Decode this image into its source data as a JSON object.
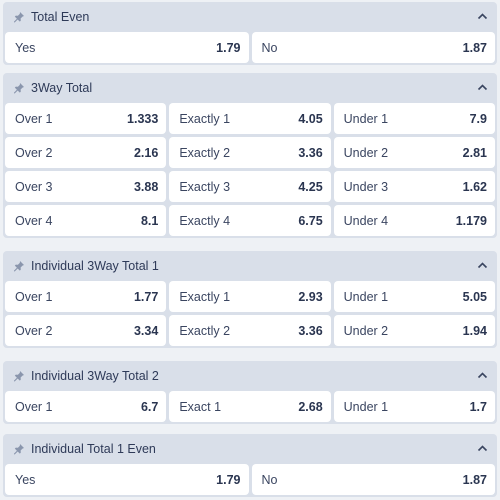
{
  "markets": [
    {
      "title": "Total Even",
      "outcomes": [
        {
          "label": "Yes",
          "odd": "1.79"
        },
        {
          "label": "No",
          "odd": "1.87"
        }
      ]
    },
    {
      "title": "3Way Total",
      "outcomes": [
        {
          "label": "Over 1",
          "odd": "1.333"
        },
        {
          "label": "Exactly 1",
          "odd": "4.05"
        },
        {
          "label": "Under 1",
          "odd": "7.9"
        },
        {
          "label": "Over 2",
          "odd": "2.16"
        },
        {
          "label": "Exactly 2",
          "odd": "3.36"
        },
        {
          "label": "Under 2",
          "odd": "2.81"
        },
        {
          "label": "Over 3",
          "odd": "3.88"
        },
        {
          "label": "Exactly 3",
          "odd": "4.25"
        },
        {
          "label": "Under 3",
          "odd": "1.62"
        },
        {
          "label": "Over 4",
          "odd": "8.1"
        },
        {
          "label": "Exactly 4",
          "odd": "6.75"
        },
        {
          "label": "Under 4",
          "odd": "1.179"
        }
      ]
    },
    {
      "title": "Individual 3Way Total 1",
      "outcomes": [
        {
          "label": "Over 1",
          "odd": "1.77"
        },
        {
          "label": "Exactly 1",
          "odd": "2.93"
        },
        {
          "label": "Under 1",
          "odd": "5.05"
        },
        {
          "label": "Over 2",
          "odd": "3.34"
        },
        {
          "label": "Exactly 2",
          "odd": "3.36"
        },
        {
          "label": "Under 2",
          "odd": "1.94"
        }
      ]
    },
    {
      "title": "Individual 3Way Total 2",
      "outcomes": [
        {
          "label": "Over 1",
          "odd": "6.7"
        },
        {
          "label": "Exact 1",
          "odd": "2.68"
        },
        {
          "label": "Under 1",
          "odd": "1.7"
        }
      ]
    },
    {
      "title": "Individual Total 1 Even",
      "outcomes": [
        {
          "label": "Yes",
          "odd": "1.79"
        },
        {
          "label": "No",
          "odd": "1.87"
        }
      ]
    }
  ],
  "icons": {
    "pin": "pin-icon",
    "collapse": "chevron-up-icon"
  },
  "colors": {
    "panel": "#d9dfe9",
    "cell": "#ffffff",
    "text": "#2a3550",
    "icon": "#8a96ad"
  }
}
